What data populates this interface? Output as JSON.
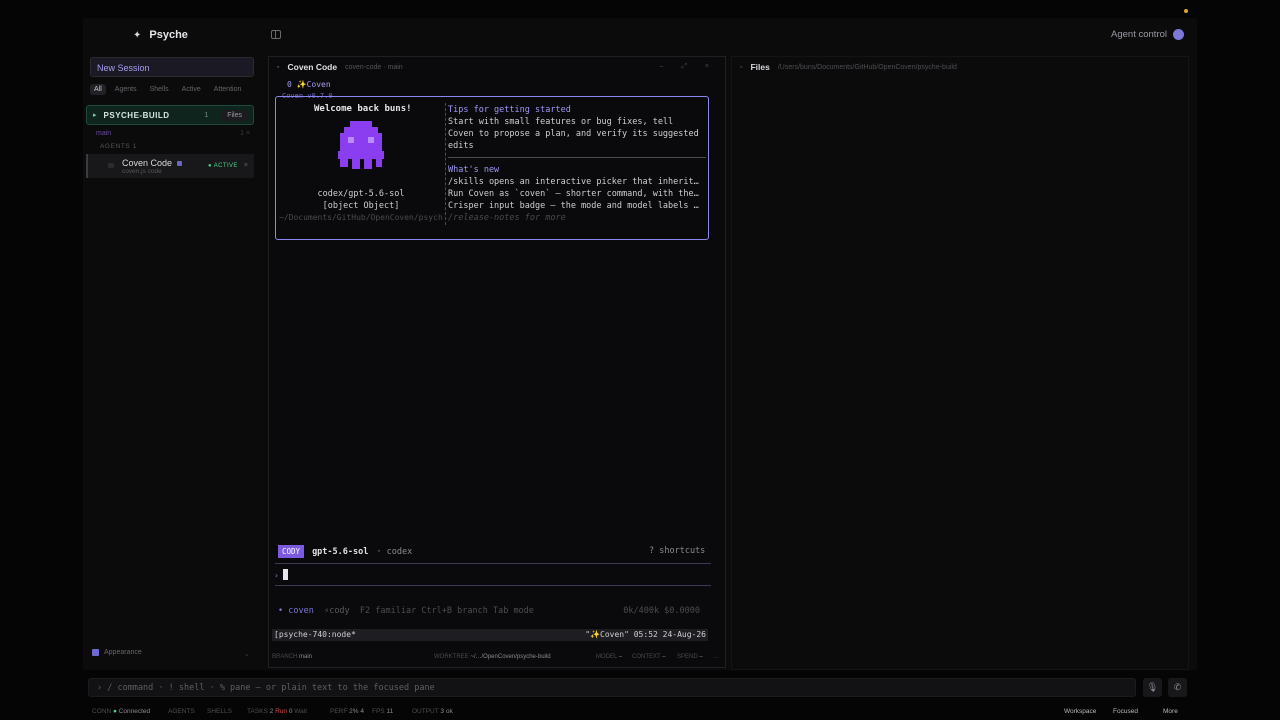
{
  "app": {
    "name": "Psyche",
    "agent_control": "Agent control"
  },
  "sidebar": {
    "new_session": "New Session",
    "filters": [
      "All",
      "Agents",
      "Shells",
      "Active",
      "Attention"
    ],
    "project": {
      "name": "PSYCHE-BUILD",
      "count": "1",
      "files_label": "Files"
    },
    "branch": {
      "name": "main",
      "x": "1 ×"
    },
    "agents_label": "AGENTS 1",
    "agent": {
      "title": "Coven Code",
      "sub": "coven.js code",
      "status": "● ACTIVE",
      "close": "×"
    },
    "appearance": "Appearance",
    "appearance_caret": "⌄"
  },
  "pane": {
    "title": "Coven Code",
    "subtitle": "coven-code · main",
    "controls": "– ⤢ ×",
    "tab": "0 ✨Coven",
    "version": "Coven v0.7.0",
    "welcome": "Welcome back buns!",
    "model": "codex/gpt-5.6-sol",
    "status": {
      "branch_label": "BRANCH",
      "branch": "main",
      "worktree_label": "WORKTREE",
      "worktree": "~/…/OpenCoven/psyche-build",
      "model_label": "MODEL",
      "model": "–",
      "context_label": "CONTEXT",
      "context": "–",
      "spend_label": "SPEND",
      "spend": "–",
      "more": "…"
    },
    "cwd": "~/Documents/GitHub/OpenCoven/psyche-build",
    "tips_head": "Tips for getting started",
    "tips": [
      "Start with small features or bug fixes, tell",
      "Coven to propose a plan, and verify its suggested",
      "edits"
    ],
    "news_head": "What's new",
    "news": [
      "/skills opens an interactive picker that inherit…",
      "Run Coven as `coven` — shorter command, with the…",
      "Crisper input badge — the mode and model labels …"
    ],
    "release_notes": "/release-notes for more",
    "prompt": {
      "badge": "CODY",
      "model": "gpt-5.6-sol",
      "provider": "· codex",
      "shortcuts": "? shortcuts",
      "caret": "›"
    },
    "mode_line": {
      "coven": "• coven",
      "cody": "⚡cody",
      "rest": "F2 familiar  Ctrl+B branch  Tab mode",
      "right": "0k/400k  $0.0000"
    },
    "tmux": {
      "left": "[psyche-740:node*",
      "right": "\"✨Coven\" 05:52 24-Aug-26"
    }
  },
  "files": {
    "title": "Files",
    "path": "/Users/buns/Documents/GitHub/OpenCoven/psyche-build"
  },
  "command_bar": {
    "placeholder": "›  / command · ! shell · % pane — or plain text to the focused pane"
  },
  "footer": {
    "conn_label": "CONN",
    "conn": "Connected",
    "agents": "AGENTS",
    "shells": "SHELLS",
    "tasks_label": "TASKS",
    "tasks_val": "2",
    "run": "Run",
    "run_val": "0",
    "wait": "Wait",
    "perf_label": "PERF",
    "perf_val": "2% 4",
    "fps_label": "FPS",
    "fps_val": "11",
    "output_label": "OUTPUT",
    "output_val": "3 ok",
    "workspace": "Workspace",
    "focused": "Focused",
    "more": "More"
  },
  "colors": {
    "accent": "#7b78d8",
    "active": "#4fd08c",
    "badge": "#7b5ae0"
  }
}
